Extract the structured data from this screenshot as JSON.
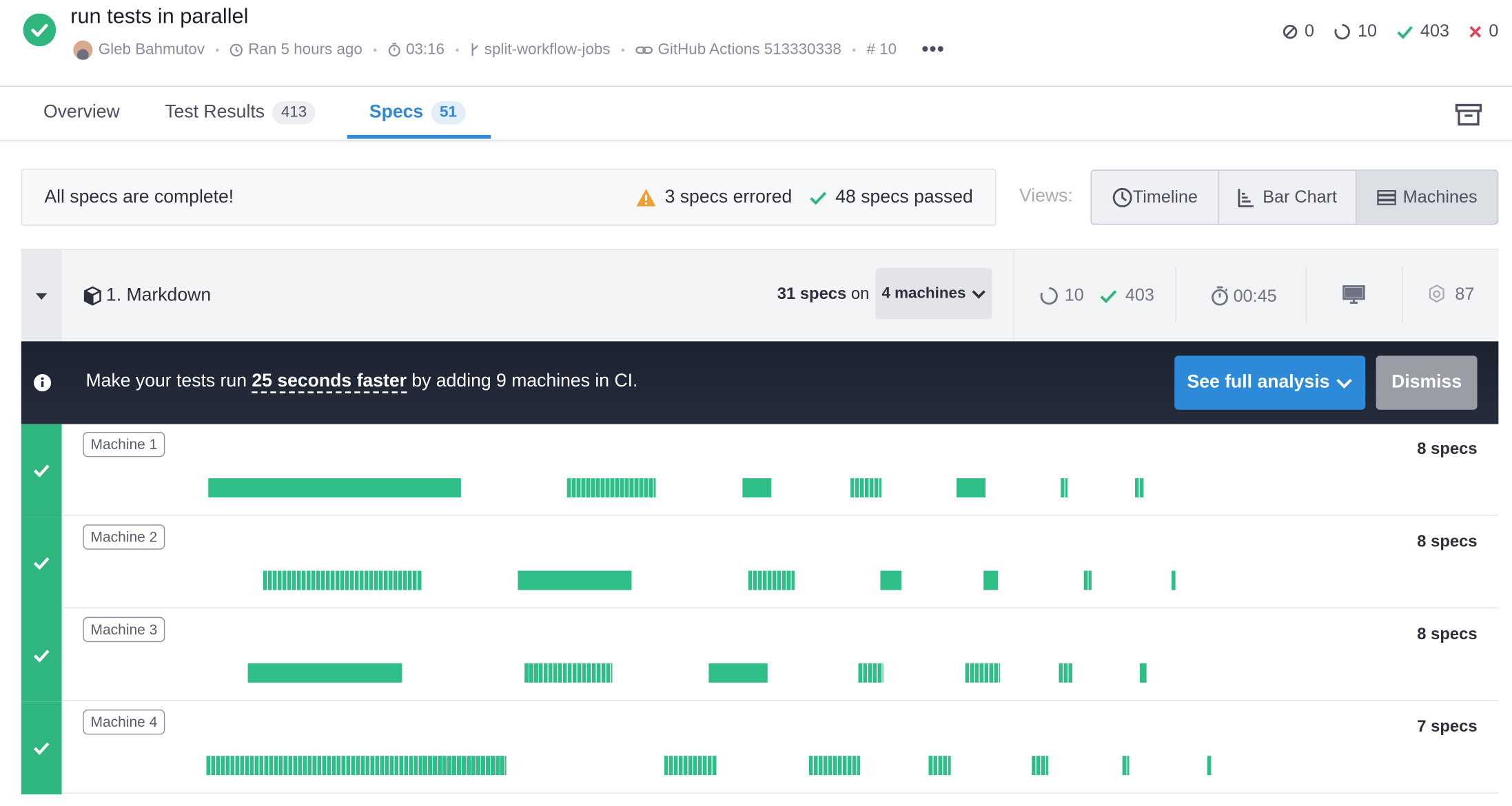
{
  "run": {
    "title": "run tests in parallel",
    "author": "Gleb Bahmutov",
    "ran": "Ran 5 hours ago",
    "duration": "03:16",
    "branch": "split-workflow-jobs",
    "ci": "GitHub Actions 513330338",
    "number": "# 10"
  },
  "counts": {
    "skipped": "0",
    "pending": "10",
    "passed": "403",
    "failed": "0"
  },
  "tabs": [
    {
      "label": "Overview",
      "count": ""
    },
    {
      "label": "Test Results",
      "count": "413"
    },
    {
      "label": "Specs",
      "count": "51"
    }
  ],
  "status": {
    "message": "All specs are complete!",
    "errored": "3 specs errored",
    "passed": "48 specs passed"
  },
  "views": {
    "label": "Views:",
    "timeline": "Timeline",
    "bar_chart": "Bar Chart",
    "machines": "Machines",
    "selected": "Machines"
  },
  "group": {
    "name": "1. Markdown",
    "specs_count": "31 specs",
    "specs_on": "on",
    "machines": "4 machines",
    "pending": "10",
    "passed": "403",
    "duration": "00:45",
    "flake": "87"
  },
  "banner": {
    "prefix": "Make your tests run",
    "highlight": "25 seconds faster",
    "suffix": "by adding 9 machines in CI.",
    "analysis_button": "See full analysis",
    "dismiss_button": "Dismiss"
  },
  "machines": [
    {
      "label": "Machine 1",
      "specs": "8 specs"
    },
    {
      "label": "Machine 2",
      "specs": "8 specs"
    },
    {
      "label": "Machine 3",
      "specs": "8 specs"
    },
    {
      "label": "Machine 4",
      "specs": "7 specs"
    }
  ],
  "colors": {
    "accent": "#3486d6",
    "success": "#2fb67e",
    "bar": "#2fbd88",
    "warning": "#f0a030",
    "fail": "#e04353"
  }
}
